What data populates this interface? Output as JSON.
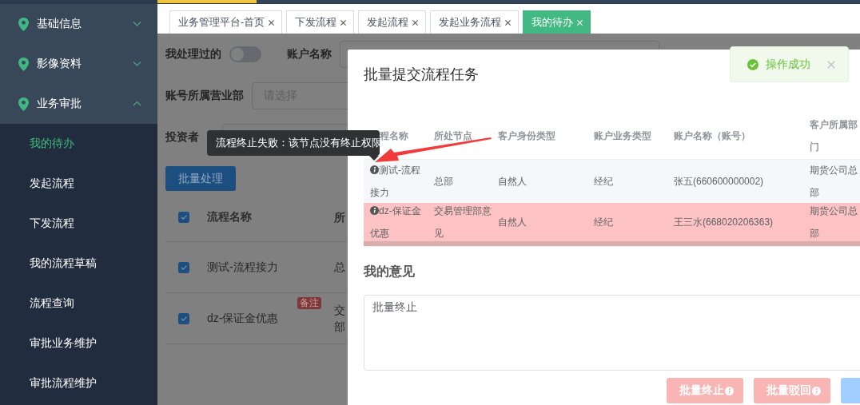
{
  "progress": {
    "level": 0.141
  },
  "sidebar": {
    "groups": [
      {
        "label": "基础信息",
        "expanded": false
      },
      {
        "label": "影像资料",
        "expanded": false
      },
      {
        "label": "业务审批",
        "expanded": true,
        "items": [
          {
            "label": "我的待办",
            "selected": true
          },
          {
            "label": "发起流程",
            "selected": false
          },
          {
            "label": "下发流程",
            "selected": false
          },
          {
            "label": "我的流程草稿",
            "selected": false
          },
          {
            "label": "流程查询",
            "selected": false
          },
          {
            "label": "审批业务维护",
            "selected": false
          },
          {
            "label": "审批流程维护",
            "selected": false
          }
        ]
      }
    ]
  },
  "tabs": [
    {
      "label": "业务管理平台-首页",
      "selected": false
    },
    {
      "label": "下发流程",
      "selected": false
    },
    {
      "label": "发起流程",
      "selected": false
    },
    {
      "label": "发起业务流程",
      "selected": false
    },
    {
      "label": "我的待办",
      "selected": true
    }
  ],
  "filters": {
    "handled": {
      "label": "我处理过的",
      "on": false
    },
    "account_name": {
      "label": "账户名称"
    },
    "branch": {
      "label": "账号所属营业部",
      "placeholder": "请选择"
    },
    "investor": {
      "label": "投资者"
    }
  },
  "batch_button": "批量处理",
  "list": {
    "all_checked": true,
    "columns": [
      "流程名称",
      "所"
    ],
    "rows": [
      {
        "checked": true,
        "name": "测试-流程接力",
        "node": [
          "总"
        ]
      },
      {
        "checked": true,
        "name": "dz-保证金优惠",
        "badge": "备注",
        "node": [
          "交",
          "部"
        ]
      }
    ]
  },
  "tooltip": "流程终止失败：该节点没有终止权限",
  "dialog": {
    "title": "批量提交流程任务",
    "columns": [
      "程名称",
      "所处节点",
      "客户身份类型",
      "账户业务类型",
      "账户名称（账号）",
      "客户所属部门"
    ],
    "rows": [
      {
        "failed": false,
        "cells": [
          "测试-流程接力",
          "总部",
          "自然人",
          "经纪",
          "张五(660600000002)",
          "期货公司总部"
        ]
      },
      {
        "failed": true,
        "cells": [
          "dz-保证金优惠",
          "交易管理部意见",
          "自然人",
          "经纪",
          "王三水(668020206363)",
          "期货公司总部"
        ]
      }
    ],
    "opinion_label": "我的意见",
    "opinion": "批量终止",
    "buttons": [
      {
        "kind": "danger",
        "label": "批量终止",
        "disabled": true
      },
      {
        "kind": "danger",
        "label": "批量驳回",
        "disabled": true
      },
      {
        "kind": "primary",
        "disabled": true
      }
    ]
  },
  "toast": {
    "message": "操作成功"
  }
}
